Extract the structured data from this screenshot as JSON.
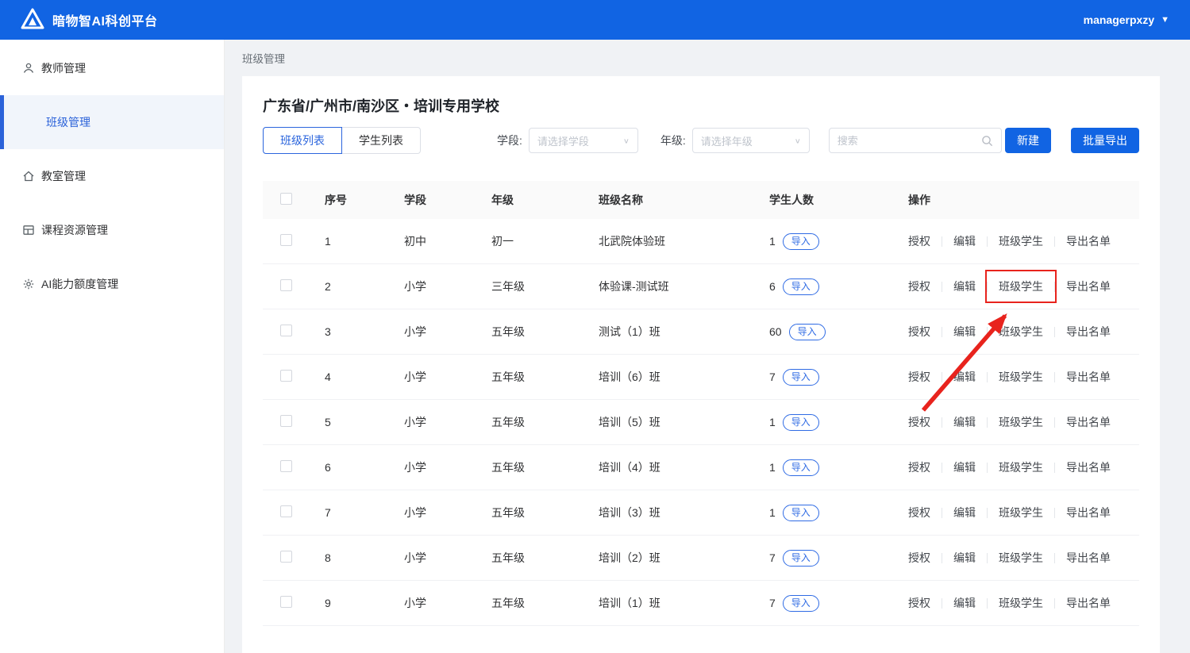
{
  "header": {
    "brand": "暗物智AI科创平台",
    "user": "managerpxzy"
  },
  "sidebar": {
    "items": [
      {
        "label": "教师管理",
        "icon": "user-icon",
        "active": false
      },
      {
        "label": "班级管理",
        "icon": "",
        "active": true
      },
      {
        "label": "教室管理",
        "icon": "home-icon",
        "active": false
      },
      {
        "label": "课程资源管理",
        "icon": "grid-icon",
        "active": false
      },
      {
        "label": "AI能力额度管理",
        "icon": "gear-icon",
        "active": false
      }
    ]
  },
  "breadcrumb": "班级管理",
  "main": {
    "school_title": "广东省/广州市/南沙区・培训专用学校",
    "tabs": [
      {
        "label": "班级列表",
        "active": true
      },
      {
        "label": "学生列表",
        "active": false
      }
    ],
    "filters": {
      "stage_label": "学段:",
      "stage_placeholder": "请选择学段",
      "grade_label": "年级:",
      "grade_placeholder": "请选择年级",
      "search_placeholder": "搜索"
    },
    "buttons": {
      "create": "新建",
      "batch_export": "批量导出"
    },
    "table": {
      "columns": [
        "序号",
        "学段",
        "年级",
        "班级名称",
        "学生人数",
        "操作"
      ],
      "import_label": "导入",
      "actions": [
        "授权",
        "编辑",
        "班级学生",
        "导出名单"
      ],
      "rows": [
        {
          "no": "1",
          "stage": "初中",
          "grade": "初一",
          "name": "北武院体验班",
          "count": "1"
        },
        {
          "no": "2",
          "stage": "小学",
          "grade": "三年级",
          "name": "体验课-测试班",
          "count": "6"
        },
        {
          "no": "3",
          "stage": "小学",
          "grade": "五年级",
          "name": "测试（1）班",
          "count": "60"
        },
        {
          "no": "4",
          "stage": "小学",
          "grade": "五年级",
          "name": "培训（6）班",
          "count": "7"
        },
        {
          "no": "5",
          "stage": "小学",
          "grade": "五年级",
          "name": "培训（5）班",
          "count": "1"
        },
        {
          "no": "6",
          "stage": "小学",
          "grade": "五年级",
          "name": "培训（4）班",
          "count": "1"
        },
        {
          "no": "7",
          "stage": "小学",
          "grade": "五年级",
          "name": "培训（3）班",
          "count": "1"
        },
        {
          "no": "8",
          "stage": "小学",
          "grade": "五年级",
          "name": "培训（2）班",
          "count": "7"
        },
        {
          "no": "9",
          "stage": "小学",
          "grade": "五年级",
          "name": "培训（1）班",
          "count": "7"
        }
      ]
    }
  },
  "annotation": {
    "description": "red box with arrow highlighting 班级学生 action of row 2",
    "row_index": 1,
    "action_index": 2,
    "color": "#e8231d"
  },
  "colors": {
    "primary": "#1164e3",
    "annotation_red": "#e8231d"
  }
}
